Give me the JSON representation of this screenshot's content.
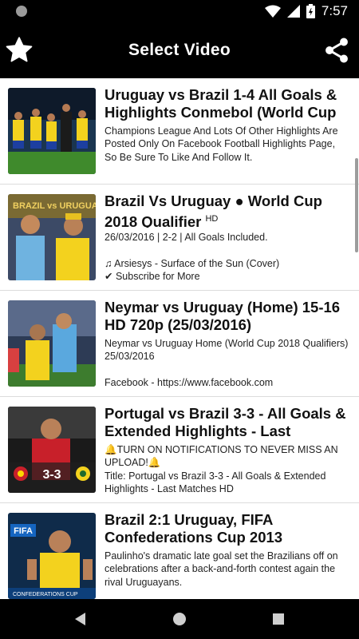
{
  "status": {
    "time": "7:57"
  },
  "appbar": {
    "title": "Select Video"
  },
  "videos": [
    {
      "title": "Uruguay vs Brazil 1-4 All Goals & Highlights Conmebol (World Cup",
      "title_sup": "",
      "description": "Champions League And Lots Of Other Highlights Are Posted Only On Facebook Football Highlights Page, So Be Sure To Like And Follow It."
    },
    {
      "title": "Brazil Vs Uruguay ● World Cup 2018 Qualifier",
      "title_sup": "HD",
      "description": "26/03/2016 | 2-2 |  All Goals Included.\n\n♫ Arsiesys - Surface of the Sun (Cover)\n✔ Subscribe for More"
    },
    {
      "title": "Neymar vs Uruguay (Home) 15-16 HD 720p (25/03/2016)",
      "title_sup": "",
      "description": "Neymar vs Uruguay Home (World Cup 2018 Qualifiers) 25/03/2016\n\nFacebook - https://www.facebook.com"
    },
    {
      "title": "Portugal vs Brazil 3-3 - All Goals & Extended Highlights - Last",
      "title_sup": "",
      "description": "🔔TURN ON NOTIFICATIONS TO NEVER MISS AN UPLOAD!🔔\nTitle: Portugal vs Brazil 3-3 - All Goals & Extended Highlights - Last Matches HD"
    },
    {
      "title": "Brazil 2:1 Uruguay, FIFA Confederations Cup 2013",
      "title_sup": "",
      "description": "Paulinho's dramatic late goal set the Brazilians off on celebrations after a back-and-forth contest again the rival Uruguayans."
    }
  ],
  "thumbnails": {
    "thumb2_text": "BRAZIL vs URUGUAY",
    "thumb4_score": "3-3",
    "thumb5_logo": "FIFA",
    "thumb5_caption": "CONFEDERATIONS CUP"
  }
}
